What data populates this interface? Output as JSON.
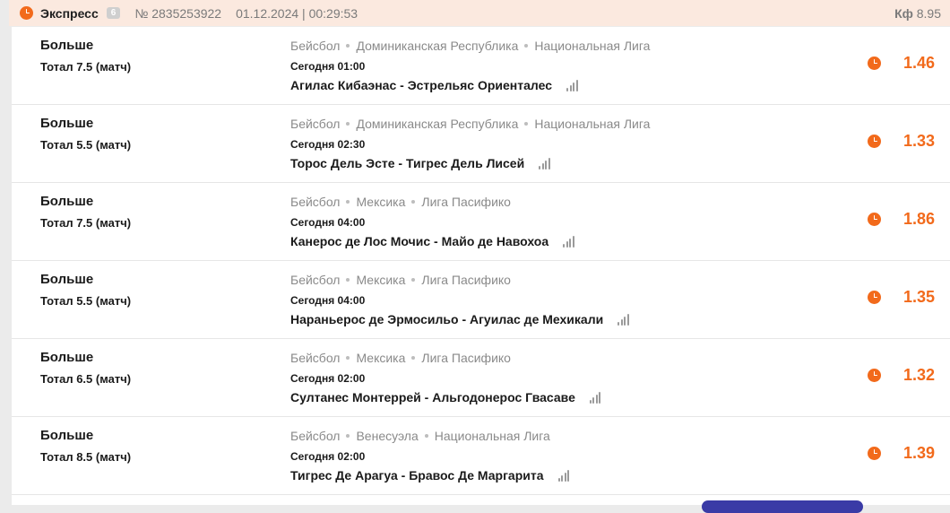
{
  "header": {
    "title": "Экспресс",
    "count": "6",
    "number": "№ 2835253922",
    "datetime": "01.12.2024 | 00:29:53",
    "coef_label": "Кф",
    "coef_value": "8.95",
    "icon": "clock-icon",
    "background": "#fbe9df"
  },
  "accent_color": "#f26a1b",
  "bets": [
    {
      "type": "Больше",
      "total": "Тотал 7.5 (матч)",
      "sport": "Бейсбол",
      "country": "Доминиканская Республика",
      "league": "Национальная Лига",
      "time": "Сегодня 01:00",
      "match": "Агилас Кибаэнас - Эстрельяс Ориенталес",
      "odds": "1.46"
    },
    {
      "type": "Больше",
      "total": "Тотал 5.5 (матч)",
      "sport": "Бейсбол",
      "country": "Доминиканская Республика",
      "league": "Национальная Лига",
      "time": "Сегодня 02:30",
      "match": "Торос Дель Эсте - Тигрес Дель Лисей",
      "odds": "1.33"
    },
    {
      "type": "Больше",
      "total": "Тотал 7.5 (матч)",
      "sport": "Бейсбол",
      "country": "Мексика",
      "league": "Лига Пасифико",
      "time": "Сегодня 04:00",
      "match": "Канерос де Лос Мочис - Майо де Навохоа",
      "odds": "1.86"
    },
    {
      "type": "Больше",
      "total": "Тотал 5.5 (матч)",
      "sport": "Бейсбол",
      "country": "Мексика",
      "league": "Лига Пасифико",
      "time": "Сегодня 04:00",
      "match": "Нараньерос де Эрмосильо - Агуилас де Мехикали",
      "odds": "1.35"
    },
    {
      "type": "Больше",
      "total": "Тотал 6.5 (матч)",
      "sport": "Бейсбол",
      "country": "Мексика",
      "league": "Лига Пасифико",
      "time": "Сегодня 02:00",
      "match": "Султанес Монтеррей - Альгодонерос Гвасаве",
      "odds": "1.32"
    },
    {
      "type": "Больше",
      "total": "Тотал 8.5 (матч)",
      "sport": "Бейсбол",
      "country": "Венесуэла",
      "league": "Национальная Лига",
      "time": "Сегодня 02:00",
      "match": "Тигрес Де Арагуа - Бравос Де Маргарита",
      "odds": "1.39"
    }
  ]
}
